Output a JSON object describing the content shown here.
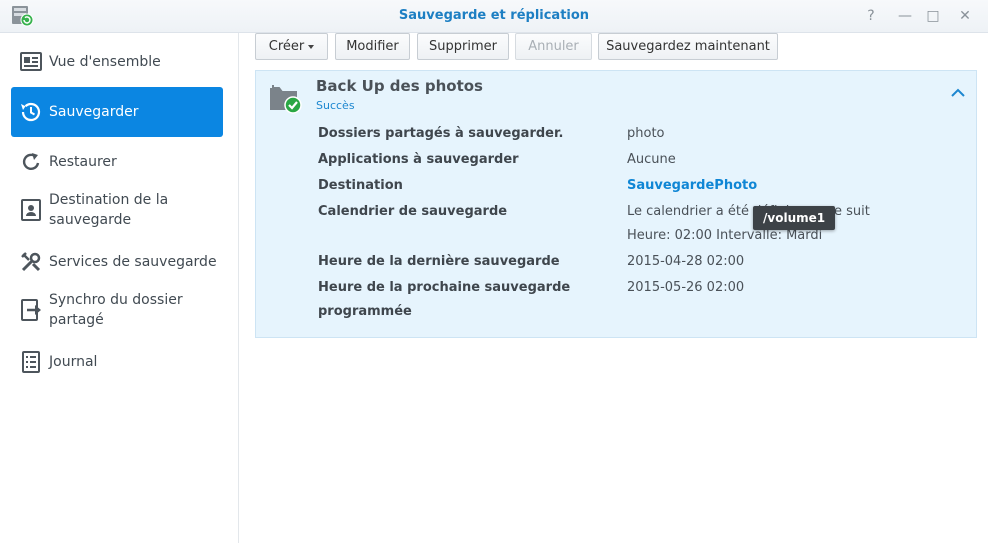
{
  "window": {
    "title": "Sauvegarde et réplication",
    "controls": {
      "help": "?",
      "pin": "—",
      "maximize": "□",
      "close": "✕"
    }
  },
  "sidebar": {
    "items": [
      {
        "label": "Vue d'ensemble",
        "icon": "overview-icon",
        "active": false
      },
      {
        "label": "Sauvegarder",
        "icon": "backup-clock-icon",
        "active": true
      },
      {
        "label": "Restaurer",
        "icon": "restore-icon",
        "active": false
      },
      {
        "label_line1": "Destination de la",
        "label_line2": "sauvegarde",
        "icon": "destination-icon",
        "active": false
      },
      {
        "label": "Services de sauvegarde",
        "icon": "tools-icon",
        "active": false
      },
      {
        "label_line1": "Synchro du dossier",
        "label_line2": "partagé",
        "icon": "sync-folder-icon",
        "active": false
      },
      {
        "label": "Journal",
        "icon": "log-icon",
        "active": false
      }
    ]
  },
  "toolbar": {
    "create": "Créer",
    "modify": "Modifier",
    "delete": "Supprimer",
    "cancel": "Annuler",
    "backup_now": "Sauvegardez maintenant"
  },
  "task": {
    "title": "Back Up des photos",
    "status": "Succès",
    "details": [
      {
        "label": "Dossiers partagés à sauvegarder.",
        "value": "photo"
      },
      {
        "label": "Applications à sauvegarder",
        "value": "Aucune"
      },
      {
        "label": "Destination",
        "value": "SauvegardePhoto"
      },
      {
        "label": "Calendrier de sauvegarde",
        "value_line1": "Le calendrier a été défini comme suit",
        "value_line2": "Heure: 02:00 Intervalle: Mardi"
      },
      {
        "label": "Heure de la dernière sauvegarde",
        "value": "2015-04-28 02:00"
      },
      {
        "label_line1": "Heure de la prochaine sauvegarde",
        "label_line2": "programmée",
        "value": "2015-05-26 02:00"
      }
    ]
  },
  "tooltip": {
    "text": "/volume1"
  },
  "colors": {
    "accent": "#0b86e2",
    "title": "#1d7fc3",
    "panel_bg": "#e6f4fd",
    "success": "#2aa744"
  }
}
